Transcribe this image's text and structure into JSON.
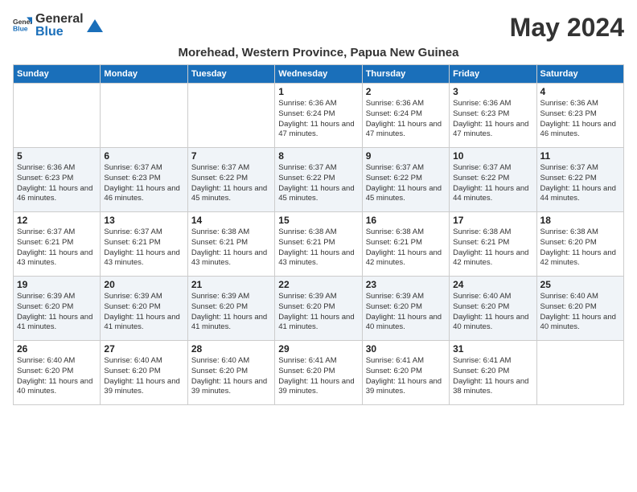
{
  "header": {
    "logo_general": "General",
    "logo_blue": "Blue",
    "month_title": "May 2024",
    "location": "Morehead, Western Province, Papua New Guinea"
  },
  "days_of_week": [
    "Sunday",
    "Monday",
    "Tuesday",
    "Wednesday",
    "Thursday",
    "Friday",
    "Saturday"
  ],
  "weeks": [
    [
      {
        "day": "",
        "info": ""
      },
      {
        "day": "",
        "info": ""
      },
      {
        "day": "",
        "info": ""
      },
      {
        "day": "1",
        "info": "Sunrise: 6:36 AM\nSunset: 6:24 PM\nDaylight: 11 hours and 47 minutes."
      },
      {
        "day": "2",
        "info": "Sunrise: 6:36 AM\nSunset: 6:24 PM\nDaylight: 11 hours and 47 minutes."
      },
      {
        "day": "3",
        "info": "Sunrise: 6:36 AM\nSunset: 6:23 PM\nDaylight: 11 hours and 47 minutes."
      },
      {
        "day": "4",
        "info": "Sunrise: 6:36 AM\nSunset: 6:23 PM\nDaylight: 11 hours and 46 minutes."
      }
    ],
    [
      {
        "day": "5",
        "info": "Sunrise: 6:36 AM\nSunset: 6:23 PM\nDaylight: 11 hours and 46 minutes."
      },
      {
        "day": "6",
        "info": "Sunrise: 6:37 AM\nSunset: 6:23 PM\nDaylight: 11 hours and 46 minutes."
      },
      {
        "day": "7",
        "info": "Sunrise: 6:37 AM\nSunset: 6:22 PM\nDaylight: 11 hours and 45 minutes."
      },
      {
        "day": "8",
        "info": "Sunrise: 6:37 AM\nSunset: 6:22 PM\nDaylight: 11 hours and 45 minutes."
      },
      {
        "day": "9",
        "info": "Sunrise: 6:37 AM\nSunset: 6:22 PM\nDaylight: 11 hours and 45 minutes."
      },
      {
        "day": "10",
        "info": "Sunrise: 6:37 AM\nSunset: 6:22 PM\nDaylight: 11 hours and 44 minutes."
      },
      {
        "day": "11",
        "info": "Sunrise: 6:37 AM\nSunset: 6:22 PM\nDaylight: 11 hours and 44 minutes."
      }
    ],
    [
      {
        "day": "12",
        "info": "Sunrise: 6:37 AM\nSunset: 6:21 PM\nDaylight: 11 hours and 43 minutes."
      },
      {
        "day": "13",
        "info": "Sunrise: 6:37 AM\nSunset: 6:21 PM\nDaylight: 11 hours and 43 minutes."
      },
      {
        "day": "14",
        "info": "Sunrise: 6:38 AM\nSunset: 6:21 PM\nDaylight: 11 hours and 43 minutes."
      },
      {
        "day": "15",
        "info": "Sunrise: 6:38 AM\nSunset: 6:21 PM\nDaylight: 11 hours and 43 minutes."
      },
      {
        "day": "16",
        "info": "Sunrise: 6:38 AM\nSunset: 6:21 PM\nDaylight: 11 hours and 42 minutes."
      },
      {
        "day": "17",
        "info": "Sunrise: 6:38 AM\nSunset: 6:21 PM\nDaylight: 11 hours and 42 minutes."
      },
      {
        "day": "18",
        "info": "Sunrise: 6:38 AM\nSunset: 6:20 PM\nDaylight: 11 hours and 42 minutes."
      }
    ],
    [
      {
        "day": "19",
        "info": "Sunrise: 6:39 AM\nSunset: 6:20 PM\nDaylight: 11 hours and 41 minutes."
      },
      {
        "day": "20",
        "info": "Sunrise: 6:39 AM\nSunset: 6:20 PM\nDaylight: 11 hours and 41 minutes."
      },
      {
        "day": "21",
        "info": "Sunrise: 6:39 AM\nSunset: 6:20 PM\nDaylight: 11 hours and 41 minutes."
      },
      {
        "day": "22",
        "info": "Sunrise: 6:39 AM\nSunset: 6:20 PM\nDaylight: 11 hours and 41 minutes."
      },
      {
        "day": "23",
        "info": "Sunrise: 6:39 AM\nSunset: 6:20 PM\nDaylight: 11 hours and 40 minutes."
      },
      {
        "day": "24",
        "info": "Sunrise: 6:40 AM\nSunset: 6:20 PM\nDaylight: 11 hours and 40 minutes."
      },
      {
        "day": "25",
        "info": "Sunrise: 6:40 AM\nSunset: 6:20 PM\nDaylight: 11 hours and 40 minutes."
      }
    ],
    [
      {
        "day": "26",
        "info": "Sunrise: 6:40 AM\nSunset: 6:20 PM\nDaylight: 11 hours and 40 minutes."
      },
      {
        "day": "27",
        "info": "Sunrise: 6:40 AM\nSunset: 6:20 PM\nDaylight: 11 hours and 39 minutes."
      },
      {
        "day": "28",
        "info": "Sunrise: 6:40 AM\nSunset: 6:20 PM\nDaylight: 11 hours and 39 minutes."
      },
      {
        "day": "29",
        "info": "Sunrise: 6:41 AM\nSunset: 6:20 PM\nDaylight: 11 hours and 39 minutes."
      },
      {
        "day": "30",
        "info": "Sunrise: 6:41 AM\nSunset: 6:20 PM\nDaylight: 11 hours and 39 minutes."
      },
      {
        "day": "31",
        "info": "Sunrise: 6:41 AM\nSunset: 6:20 PM\nDaylight: 11 hours and 38 minutes."
      },
      {
        "day": "",
        "info": ""
      }
    ]
  ]
}
